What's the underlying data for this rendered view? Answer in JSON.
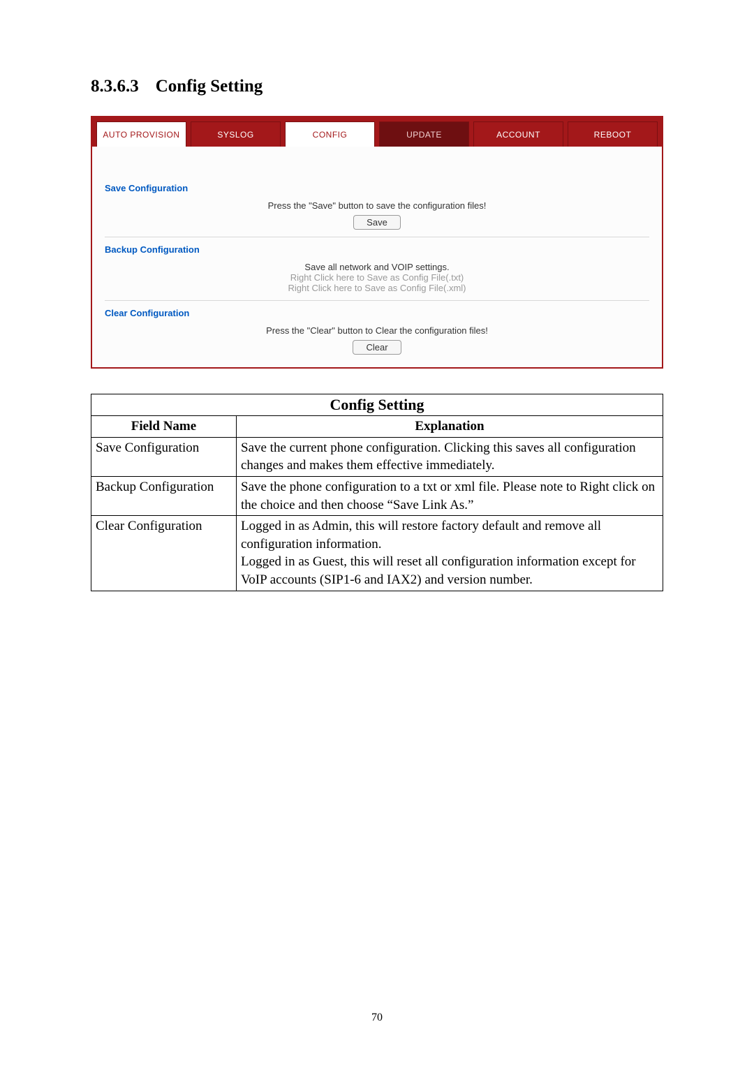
{
  "heading": {
    "number": "8.3.6.3",
    "title": "Config Setting"
  },
  "ui": {
    "tabs": [
      {
        "label": "AUTO PROVISION",
        "state": "active"
      },
      {
        "label": "SYSLOG",
        "state": "normal"
      },
      {
        "label": "CONFIG",
        "state": "active"
      },
      {
        "label": "UPDATE",
        "state": "dark"
      },
      {
        "label": "ACCOUNT",
        "state": "normal"
      },
      {
        "label": "REBOOT",
        "state": "normal"
      }
    ],
    "save": {
      "title": "Save Configuration",
      "hint": "Press the \"Save\" button to save the configuration files!",
      "button": "Save"
    },
    "backup": {
      "title": "Backup Configuration",
      "line1": "Save all network and VOIP settings.",
      "line2": "Right Click here to Save as Config File(.txt)",
      "line3": "Right Click here to Save as Config File(.xml)"
    },
    "clear": {
      "title": "Clear Configuration",
      "hint": "Press the \"Clear\" button to Clear the configuration files!",
      "button": "Clear"
    }
  },
  "table": {
    "caption": "Config Setting",
    "headers": {
      "field": "Field Name",
      "expl": "Explanation"
    },
    "rows": [
      {
        "field": "Save Configuration",
        "expl": "Save the current phone configuration. Clicking this saves all configuration changes and makes them effective immediately."
      },
      {
        "field": "Backup Configuration",
        "expl": "Save the phone configuration to a txt or xml file.    Please note to Right click on the choice and then choose “Save Link As.”"
      },
      {
        "field": "Clear Configuration",
        "expl": "Logged in as Admin, this will restore factory default and remove all configuration information.\nLogged in as Guest, this will reset all configuration information except for VoIP accounts (SIP1-6 and IAX2) and version number."
      }
    ]
  },
  "page_number": "70"
}
